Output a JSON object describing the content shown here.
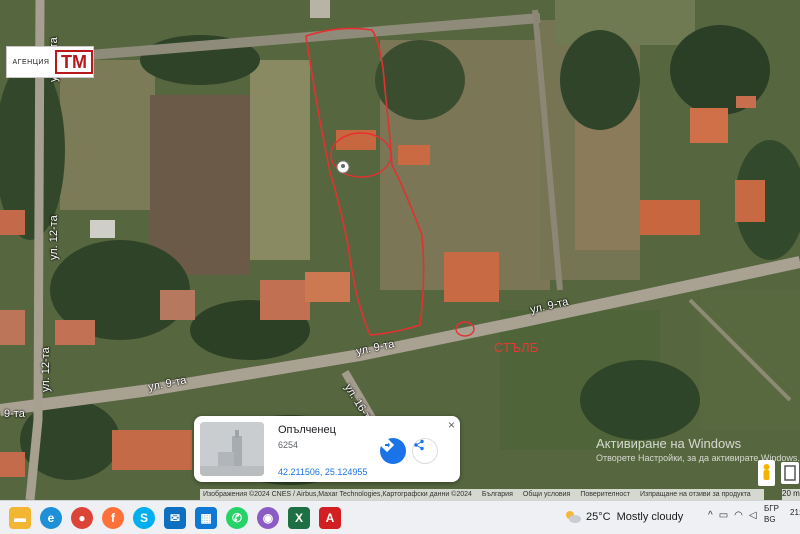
{
  "logo": {
    "agency": "АГЕНЦИЯ",
    "mark": "ТМ"
  },
  "roads": {
    "r12_top": "ул. 12-та",
    "r12_bottom": "ул. 12-та",
    "r9_a": "ул. 9-та",
    "r9_b": "ул. 9-та",
    "r9_c": "ул. 9-та",
    "r9_left": "9-та",
    "r16": "ул. 16-та"
  },
  "annotation": "СТЪЛБ",
  "place_card": {
    "title": "Опълченец",
    "postcode": "6254",
    "coords": "42.211506, 25.124955",
    "close": "×"
  },
  "attribution": {
    "imagery": "Изображения ©2024 CNES / Airbus,Maxar Technologies,Картографски данни ©2024",
    "country": "България",
    "terms": "Общи условия",
    "privacy": "Поверителност",
    "feedback": "Изпращане на отзиви за продукта",
    "scale": "20 m"
  },
  "watermark": {
    "line1": "Активиране на Windows",
    "line2": "Отворете Настройки, за да активирате Windows."
  },
  "taskbar": {
    "apps": [
      "file-explorer",
      "edge",
      "chrome",
      "firefox",
      "skype",
      "mail",
      "outlook",
      "whatsapp",
      "photos",
      "excel",
      "acrobat"
    ],
    "colors": {
      "explorer": "#f2b632",
      "edge": "#1f8fd8",
      "chrome": "#db4437",
      "firefox": "#ff7139",
      "skype": "#00aff0",
      "mail": "#0b6fc2",
      "outlook": "#0f78d4",
      "whatsapp": "#25d366",
      "photos": "#8a5cc4",
      "excel": "#1d7044",
      "acrobat": "#d21f21"
    }
  },
  "tray": {
    "temperature": "25°C",
    "condition": "Mostly cloudy",
    "lang1": "БГР",
    "lang2": "BG",
    "clock": "21:"
  }
}
